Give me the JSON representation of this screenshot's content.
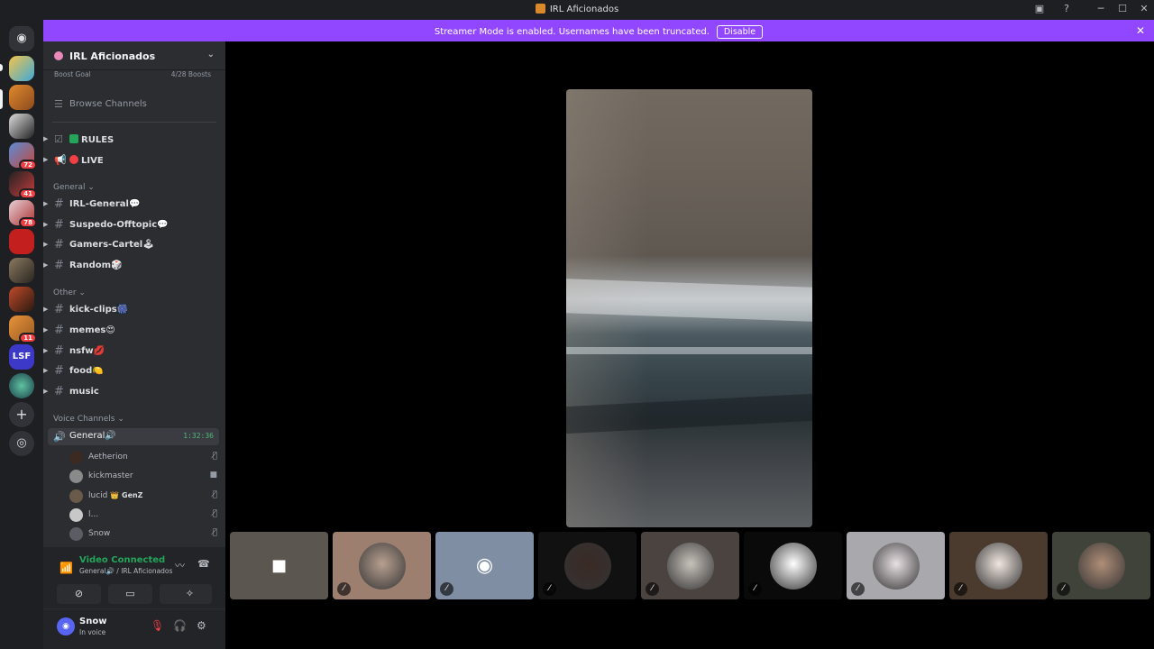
{
  "window": {
    "title": "IRL Aficionados",
    "controls": [
      "minimize-icon",
      "maximize-icon",
      "close-icon"
    ]
  },
  "banner": {
    "message": "Streamer Mode is enabled. Usernames have been truncated.",
    "button": "Disable",
    "color": "#9147ff"
  },
  "rail": {
    "badges": [
      "72",
      "41",
      "78",
      "11"
    ],
    "blocky_label": "LSF"
  },
  "server": {
    "name": "IRL Aficionados",
    "boost_goal_label": "Boost Goal",
    "boost_progress": "4/28 Boosts",
    "browse_channels": "Browse Channels"
  },
  "channels_top": [
    {
      "name": "RULES",
      "icon": "check-box-icon"
    },
    {
      "name": "LIVE",
      "icon": "red-circle-icon"
    }
  ],
  "categories": {
    "general": "General",
    "other": "Other",
    "voice": "Voice Channels"
  },
  "channels_general": [
    {
      "name": "IRL-General💬"
    },
    {
      "name": "Suspedo-Offtopic💬"
    },
    {
      "name": "Gamers-Cartel🕹"
    },
    {
      "name": "Random🎲"
    }
  ],
  "channels_other": [
    {
      "name": "kick-clips🎆"
    },
    {
      "name": "memes😍"
    },
    {
      "name": "nsfw💋"
    },
    {
      "name": "food🍋"
    },
    {
      "name": "music"
    }
  ],
  "voice_channel": {
    "name": "General🔊",
    "timer": "1:32:36",
    "users": [
      {
        "name": "Aetherion",
        "status": "muted-icon"
      },
      {
        "name": "kickmaster",
        "status": "camera-icon"
      },
      {
        "name": "lucid",
        "tag": "👑 GenZ",
        "status": "muted-icon"
      },
      {
        "name": "l...",
        "status": "muted-icon"
      },
      {
        "name": "Snow",
        "status": "muted-icon"
      }
    ]
  },
  "rtc": {
    "status": "Video Connected",
    "location": "General🔊 / IRL Aficionados"
  },
  "user": {
    "name": "Snow",
    "status": "In voice"
  },
  "tiles": [
    {
      "kind": "camera",
      "bg": "#5c5650"
    },
    {
      "kind": "avatar",
      "bg": "#9d7f70"
    },
    {
      "kind": "discord",
      "bg": "#7f8ea3"
    },
    {
      "kind": "avatar",
      "bg": "#111111"
    },
    {
      "kind": "avatar",
      "bg": "#4a4340"
    },
    {
      "kind": "avatar",
      "bg": "#0a0a0a"
    },
    {
      "kind": "avatar",
      "bg": "#a9a9ad"
    },
    {
      "kind": "avatar",
      "bg": "#4b3a2e"
    },
    {
      "kind": "avatar",
      "bg": "#3f4339"
    }
  ]
}
